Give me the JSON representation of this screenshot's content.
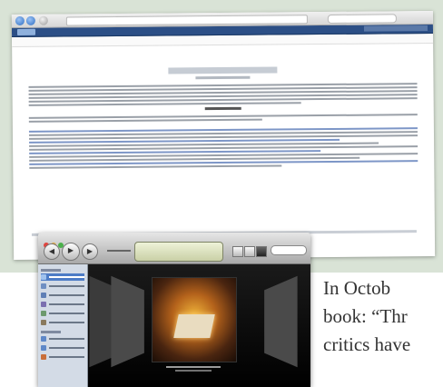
{
  "article": {
    "lines": [
      "In Octob",
      "book: “Thr",
      "critics have"
    ]
  },
  "browser": {
    "address": "",
    "search": ""
  },
  "itunes": {
    "lcd_text": ""
  },
  "colors": {
    "backdrop": "#d9e3d6",
    "site_bar": "#2c4f86",
    "sidebar_selection": "#4d7cc6"
  },
  "icons": [
    "back-icon",
    "play-icon",
    "forward-icon",
    "list-view-icon",
    "grid-view-icon",
    "coverflow-view-icon",
    "search-icon"
  ]
}
